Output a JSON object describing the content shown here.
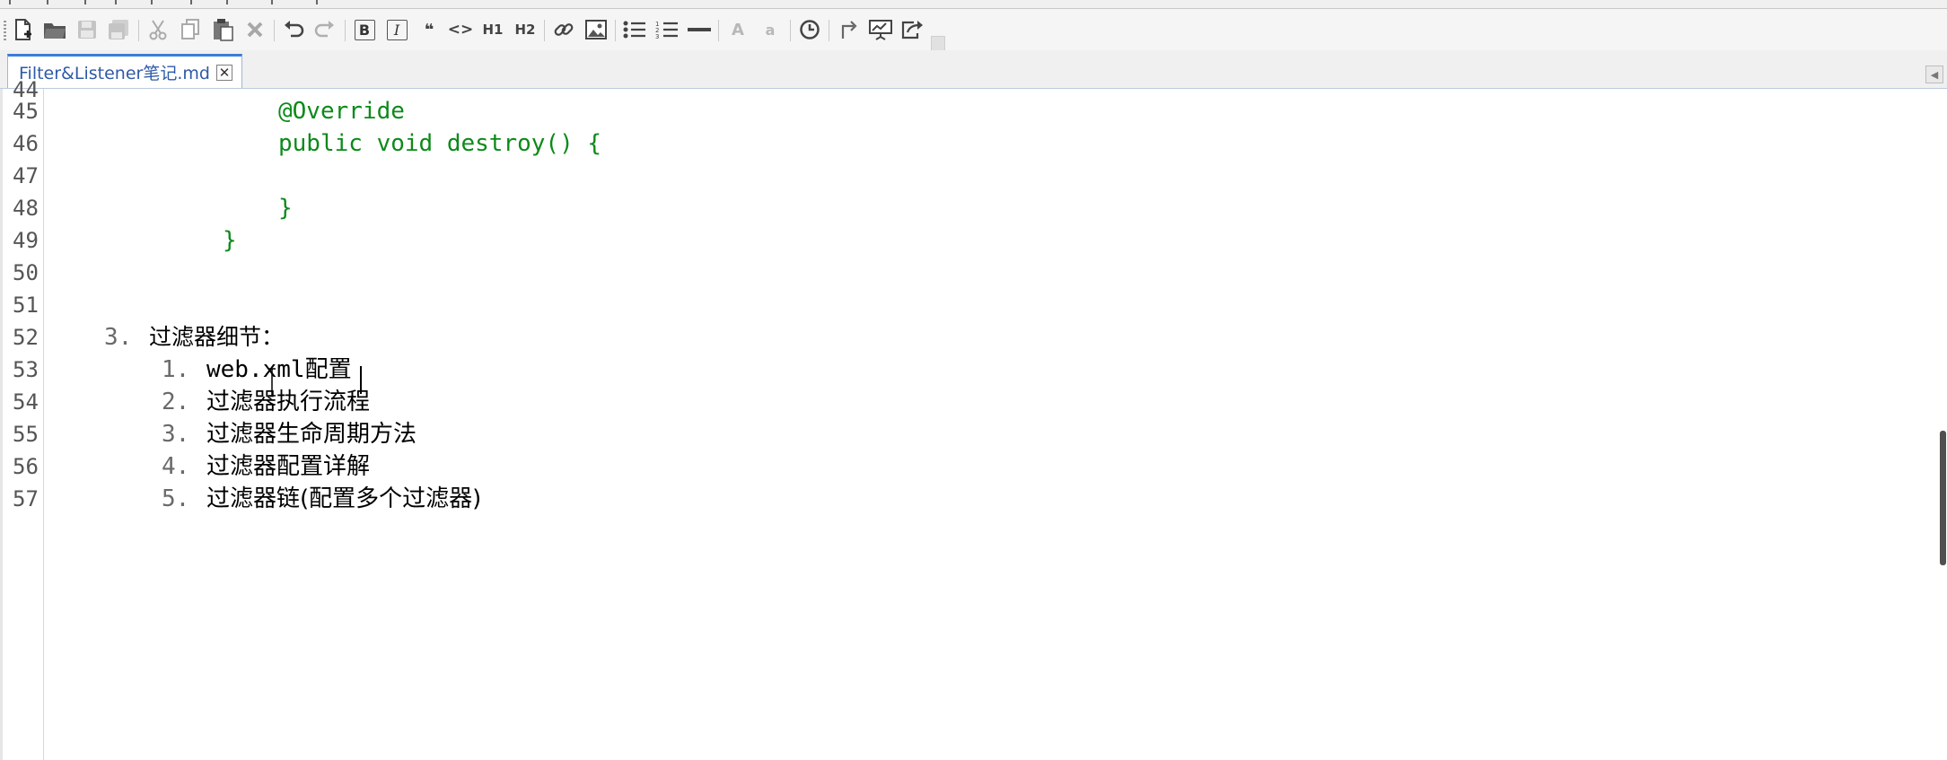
{
  "window": {
    "tab_title": "Filter&Listener笔记.md"
  },
  "toolbar": {
    "icons": [
      "new-file",
      "open-folder",
      "save",
      "save-all",
      "cut",
      "copy",
      "paste",
      "delete",
      "undo",
      "redo",
      "bold",
      "italic",
      "blockquote",
      "code",
      "h1",
      "h2",
      "link",
      "image",
      "bullet-list",
      "numbered-list",
      "horizontal-rule",
      "uppercase",
      "lowercase",
      "timestamp",
      "line-break",
      "presentation",
      "export"
    ],
    "bold_label": "B",
    "italic_label": "I",
    "quote_label": "❝",
    "code_label": "<>",
    "h1_label": "H1",
    "h2_label": "H2",
    "upper_label": "A",
    "lower_label": "a"
  },
  "editor": {
    "line_numbers": [
      "44",
      "45",
      "46",
      "47",
      "48",
      "49",
      "50",
      "51",
      "52",
      "53",
      "54",
      "55",
      "56",
      "57"
    ],
    "lines": [
      "",
      "@Override",
      "public void destroy() {",
      "",
      "}",
      "}",
      "",
      "",
      "过滤器细节：",
      "web.xml配置",
      "过滤器执行流程",
      "过滤器生命周期方法",
      "过滤器配置详解",
      "过滤器链(配置多个过滤器)"
    ],
    "list_markers": [
      "3.",
      "1.",
      "2.",
      "3.",
      "4.",
      "5."
    ],
    "colors": {
      "code_green": "#0c8a1a",
      "text": "#000000",
      "line_number": "#555555"
    }
  }
}
